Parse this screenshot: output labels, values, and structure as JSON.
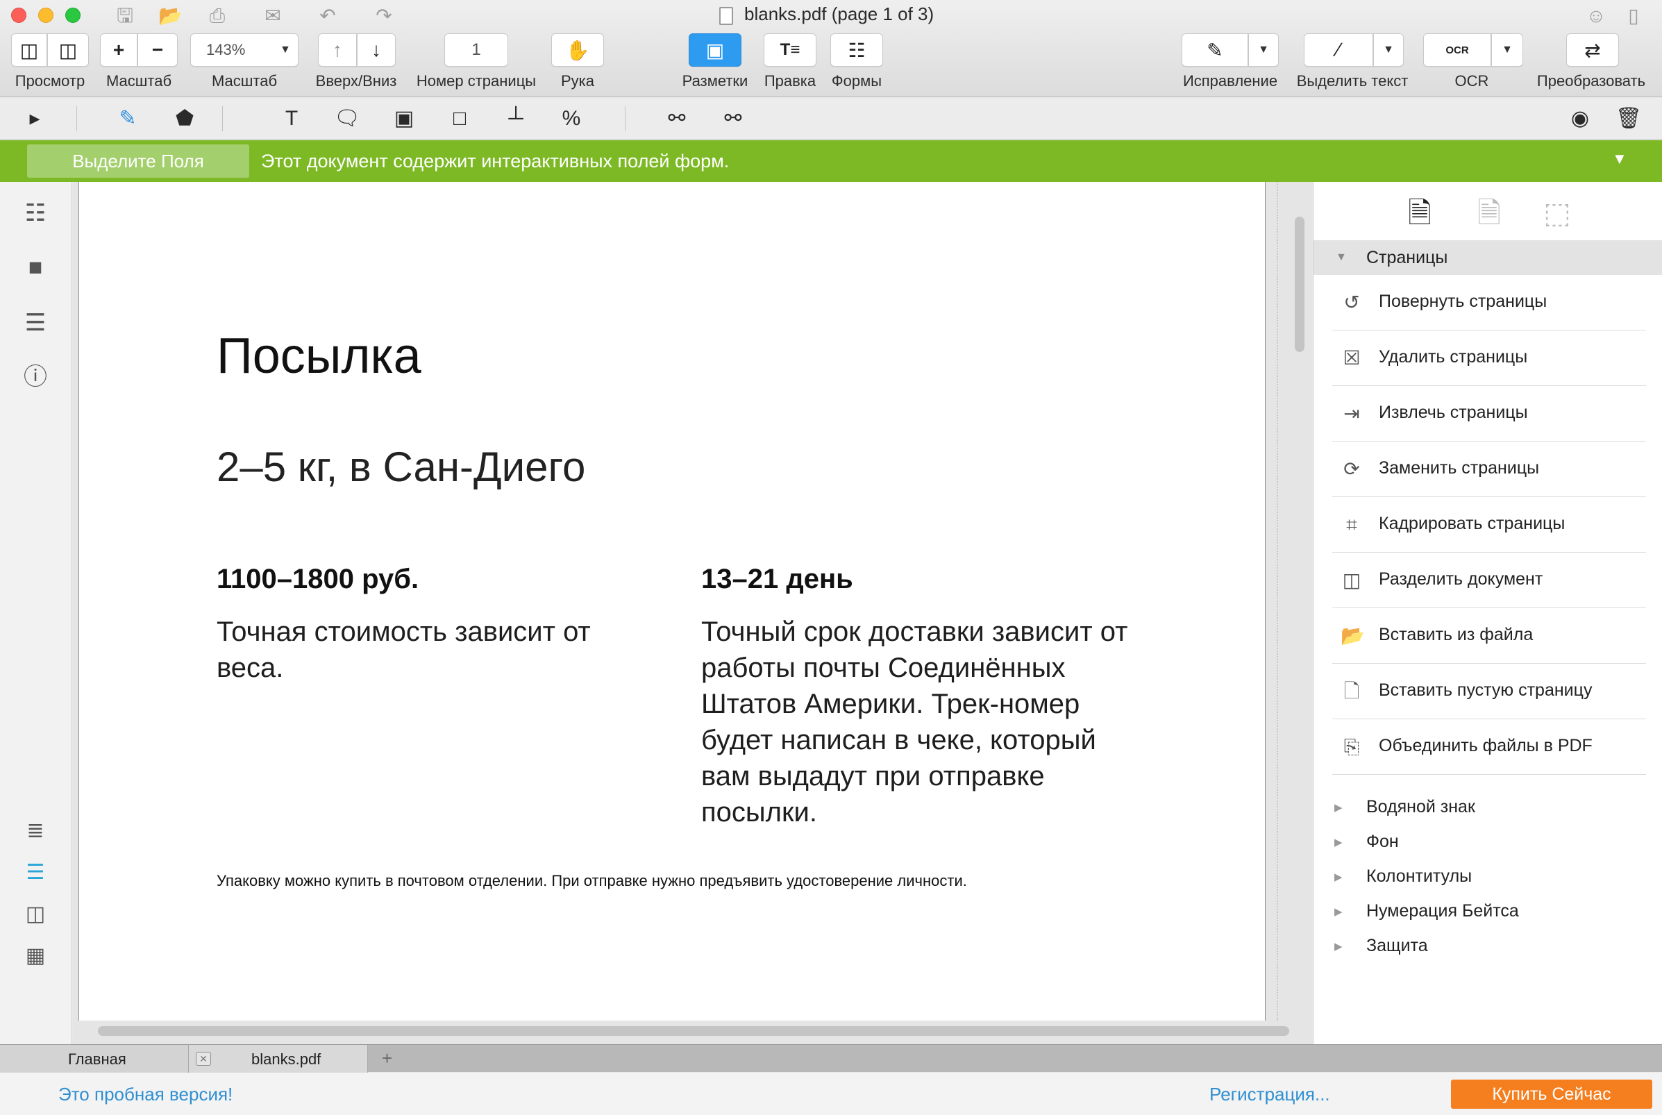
{
  "window": {
    "title": "blanks.pdf (page 1 of 3)"
  },
  "toolbar": {
    "view_label": "Просмотр",
    "scale_label": "Масштаб",
    "zoom_label": "Масштаб",
    "zoom_value": "143%",
    "updown_label": "Вверх/Вниз",
    "page_number_label": "Номер страницы",
    "page_number_value": "1",
    "hand_label": "Рука",
    "markup_label": "Разметки",
    "edit_label": "Правка",
    "forms_label": "Формы",
    "correction_label": "Исправление",
    "highlight_label": "Выделить текст",
    "ocr_label": "OCR",
    "ocr_icon_text": "OCR",
    "convert_label": "Преобразовать",
    "accent_color": "#2d9bf0"
  },
  "notice": {
    "button_label": "Выделите Поля",
    "message": "Этот документ содержит интерактивных полей форм.",
    "color": "#7db925"
  },
  "document": {
    "title": "Посылка",
    "subtitle": "2–5 кг, в Сан-Диего",
    "price_heading": "1100–1800  руб.",
    "price_text": "Точная стоимость зависит от веса.",
    "time_heading": "13–21 день",
    "time_text": "Точный срок доставки зависит от работы почты Соединённых Штатов Америки. Трек-номер будет написан в чеке, который вам выдадут при отправке посылки.",
    "footnote": "Упаковку можно купить в почтовом отделении. При отправке нужно предъявить удостоверение личности."
  },
  "panel": {
    "section_title": "Страницы",
    "items": [
      {
        "label": "Повернуть страницы",
        "icon": "rotate-pages-icon"
      },
      {
        "label": "Удалить страницы",
        "icon": "delete-pages-icon"
      },
      {
        "label": "Извлечь страницы",
        "icon": "extract-pages-icon"
      },
      {
        "label": "Заменить страницы",
        "icon": "replace-pages-icon"
      },
      {
        "label": "Кадрировать страницы",
        "icon": "crop-pages-icon"
      },
      {
        "label": "Разделить документ",
        "icon": "split-document-icon"
      },
      {
        "label": "Вставить из файла",
        "icon": "insert-from-file-icon"
      },
      {
        "label": "Вставить пустую страницу",
        "icon": "insert-blank-page-icon"
      },
      {
        "label": "Объединить файлы в PDF",
        "icon": "merge-files-icon"
      }
    ],
    "collapsed": [
      "Водяной знак",
      "Фон",
      "Колонтитулы",
      "Нумерация Бейтса",
      "Защита"
    ]
  },
  "tabs": {
    "home": "Главная",
    "file": "blanks.pdf"
  },
  "status": {
    "trial": "Это пробная версия!",
    "register": "Регистрация...",
    "buy": "Купить Сейчас",
    "buy_color": "#f57e1f",
    "link_color": "#2f8fd1"
  }
}
